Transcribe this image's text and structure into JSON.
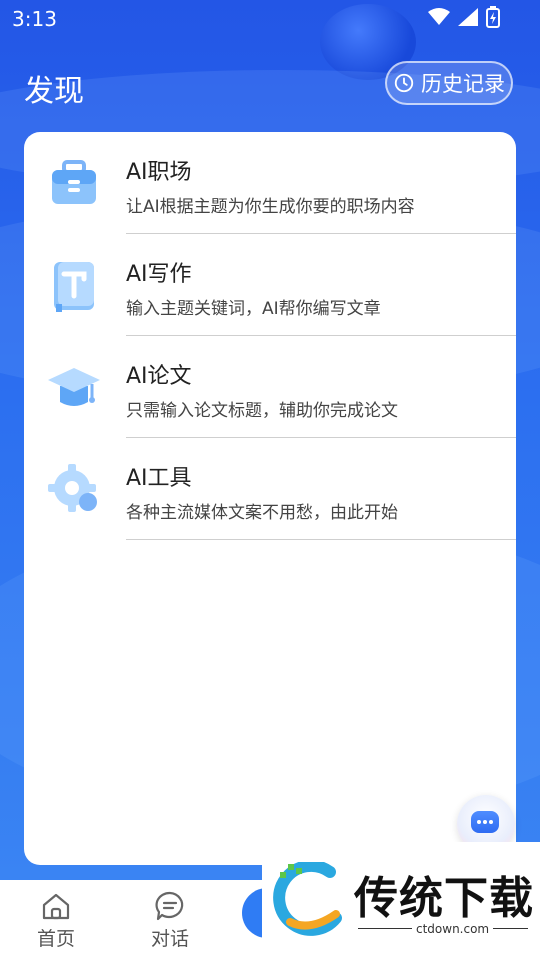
{
  "status_bar": {
    "time": "3:13"
  },
  "header": {
    "title": "发现",
    "history_label": "历史记录"
  },
  "items": [
    {
      "title": "AI职场",
      "desc": "让AI根据主题为你生成你要的职场内容",
      "icon": "briefcase-icon"
    },
    {
      "title": "AI写作",
      "desc": "输入主题关键词，AI帮你编写文章",
      "icon": "writing-book-icon"
    },
    {
      "title": "AI论文",
      "desc": "只需输入论文标题，辅助你完成论文",
      "icon": "graduation-cap-icon"
    },
    {
      "title": "AI工具",
      "desc": "各种主流媒体文案不用愁，由此开始",
      "icon": "gear-icon"
    }
  ],
  "tabbar": {
    "home_label": "首页",
    "chat_label": "对话"
  },
  "watermark": {
    "text": "传统下载",
    "url": "ctdown.com"
  },
  "colors": {
    "accent": "#2f6cf2",
    "background": "#2356e6"
  }
}
